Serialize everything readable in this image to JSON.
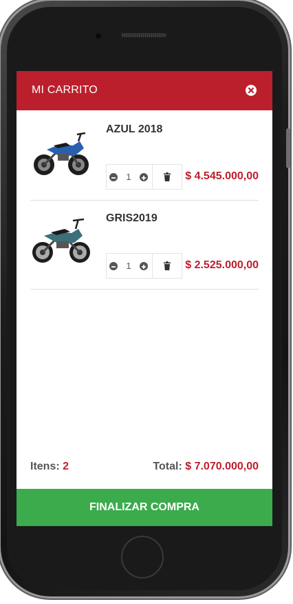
{
  "header": {
    "title": "MI CARRITO",
    "close_icon": "close-circle-icon"
  },
  "items": [
    {
      "name": "AZUL 2018",
      "quantity": "1",
      "price": "$ 4.545.000,00",
      "image": "blue-motorcycle",
      "color": "#2a5fb0"
    },
    {
      "name": "GRIS2019",
      "quantity": "1",
      "price": "$ 2.525.000,00",
      "image": "grey-motorcycle",
      "color": "#3d6f7a"
    }
  ],
  "summary": {
    "items_label": "Itens:",
    "items_count": "2",
    "total_label": "Total:",
    "total_value": "$ 7.070.000,00"
  },
  "checkout": {
    "label": "FINALIZAR COMPRA"
  },
  "colors": {
    "primary": "#bc1f2c",
    "success": "#3bab4c"
  }
}
